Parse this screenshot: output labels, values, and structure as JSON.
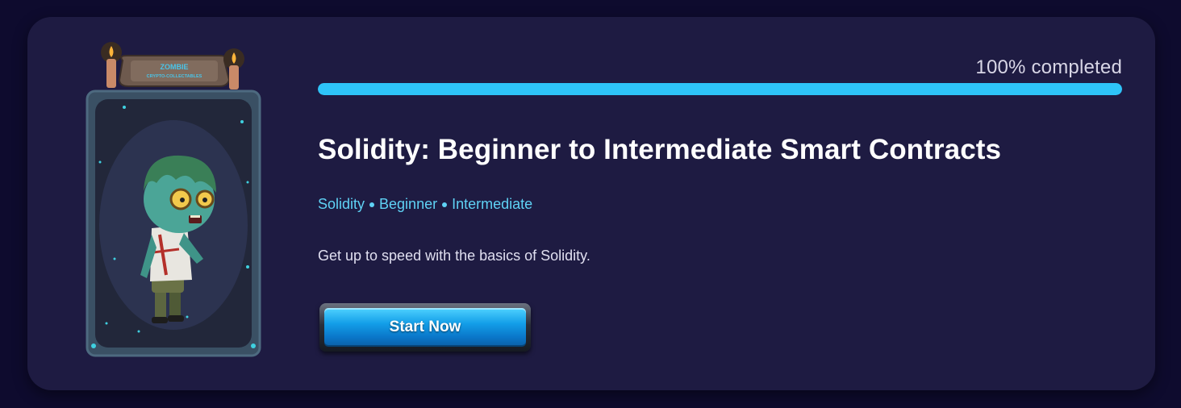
{
  "course": {
    "badge_title": "ZOMBIE",
    "badge_subtitle": "CRYPTO-COLLECTABLES",
    "progress_label": "100% completed",
    "progress_percent": 100,
    "title": "Solidity: Beginner to Intermediate Smart Contracts",
    "tags": [
      "Solidity",
      "Beginner",
      "Intermediate"
    ],
    "description": "Get up to speed with the basics of Solidity.",
    "start_label": "Start Now"
  },
  "icons": {
    "art": "zombie-character-card",
    "candles": "candle-icon"
  },
  "colors": {
    "background": "#0e0b2e",
    "card": "#1e1b42",
    "accent": "#2ec4f8",
    "tag": "#5fd2f5",
    "button": "#139ee8"
  }
}
